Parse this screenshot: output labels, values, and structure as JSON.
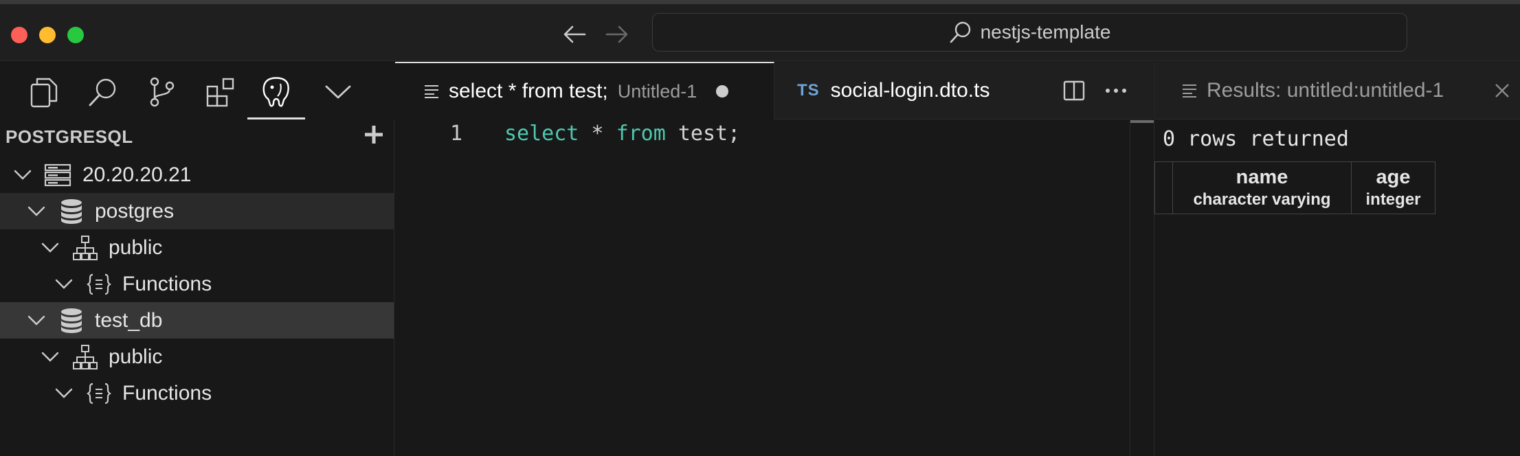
{
  "window": {
    "search_text": "nestjs-template"
  },
  "sidebar": {
    "header": "POSTGRESQL",
    "tree": [
      {
        "label": "20.20.20.21"
      },
      {
        "label": "postgres"
      },
      {
        "label": "public"
      },
      {
        "label": "Functions"
      },
      {
        "label": "test_db"
      },
      {
        "label": "public"
      },
      {
        "label": "Functions"
      }
    ]
  },
  "editor": {
    "tabs": [
      {
        "name": "select * from test;",
        "description": "Untitled-1"
      },
      {
        "badge": "TS",
        "name": "social-login.dto.ts"
      }
    ],
    "line_number": "1",
    "code": {
      "kw1": "select",
      "mid": " * ",
      "kw2": "from",
      "rest": " test;"
    }
  },
  "results": {
    "tab_label": "Results: untitled:untitled-1",
    "row_count": "0 rows returned",
    "columns": [
      {
        "name": "name",
        "type": "character varying"
      },
      {
        "name": "age",
        "type": "integer"
      }
    ]
  },
  "colors": {
    "keyword": "#4ec9b0",
    "ts_badge": "#6fa3d8",
    "background": "#181818"
  }
}
